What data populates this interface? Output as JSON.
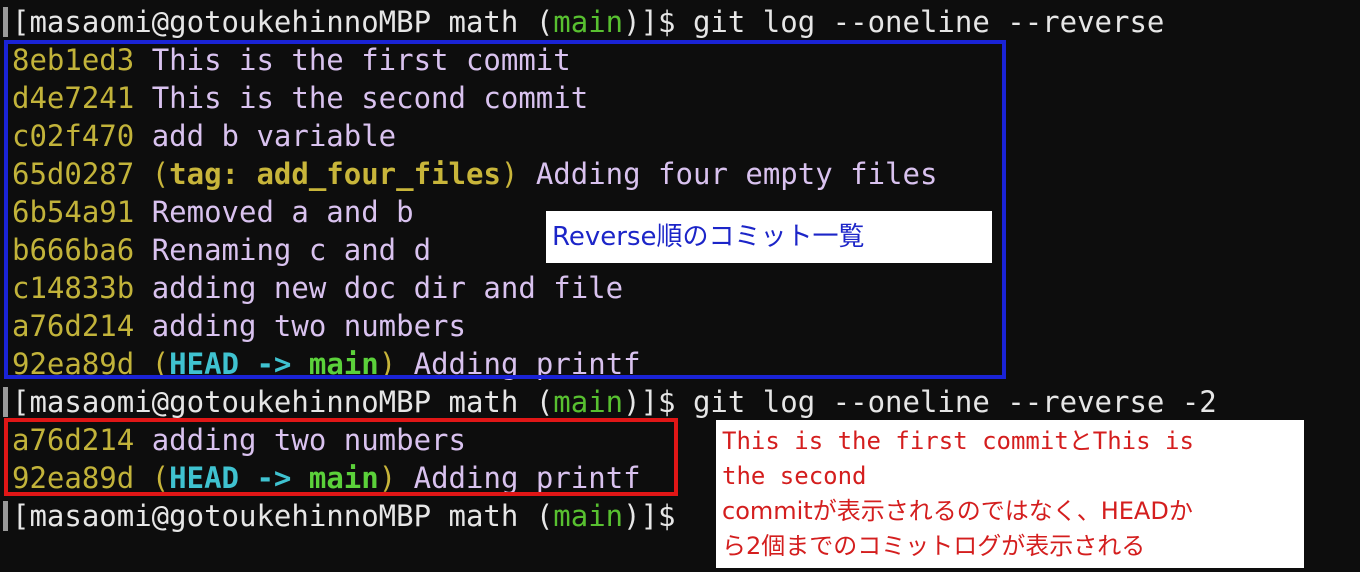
{
  "prompt": {
    "user_host": "masaomi@gotoukehinnoMBP",
    "dir": "math",
    "branch": "main"
  },
  "commands": [
    "git log --oneline --reverse",
    "git log --oneline --reverse -2"
  ],
  "log1": [
    {
      "hash": "8eb1ed3",
      "msg": "This is the first commit"
    },
    {
      "hash": "d4e7241",
      "msg": "This is the second commit"
    },
    {
      "hash": "c02f470",
      "msg": "add b variable"
    },
    {
      "hash": "65d0287",
      "tag_prefix": "tag: ",
      "tag": "add_four_files",
      "msg": "Adding four empty files"
    },
    {
      "hash": "6b54a91",
      "msg": "Removed a and b"
    },
    {
      "hash": "b666ba6",
      "msg": "Renaming c and d"
    },
    {
      "hash": "c14833b",
      "msg": "adding new doc dir and file"
    },
    {
      "hash": "a76d214",
      "msg": "adding two numbers"
    },
    {
      "hash": "92ea89d",
      "head": "HEAD",
      "arrow": "->",
      "branch": "main",
      "msg": "Adding printf"
    }
  ],
  "log2": [
    {
      "hash": "a76d214",
      "msg": "adding two numbers"
    },
    {
      "hash": "92ea89d",
      "head": "HEAD",
      "arrow": "->",
      "branch": "main",
      "msg": "Adding printf"
    }
  ],
  "annotations": {
    "blue_note": "Reverse順のコミット一覧",
    "red_note_lines": [
      "This is the first commitとThis is",
      "the second",
      "commitが表示されるのではなく、HEADか",
      "ら2個までのコミットログが表示される"
    ]
  },
  "colors": {
    "background": "#0d0d0d",
    "hash": "#c2b33a",
    "message": "#d9c2ef",
    "prompt_branch": "#58c030",
    "head": "#3fc2d0",
    "blue_box": "#1a23d6",
    "red_box": "#e01616"
  }
}
